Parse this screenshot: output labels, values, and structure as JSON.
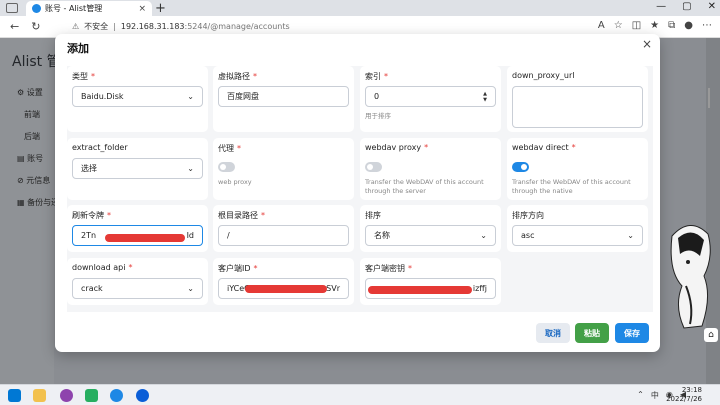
{
  "browser": {
    "tab_title": "账号 - Alist管理",
    "tab_close": "×",
    "new_tab": "+",
    "security": "不安全",
    "url_host": "192.168.31.183",
    "url_rest": ":5244/@manage/accounts"
  },
  "app": {
    "brand": "Alist 管",
    "menu": [
      {
        "label": "设置"
      },
      {
        "label": "前端"
      },
      {
        "label": "后端"
      },
      {
        "label": "账号"
      },
      {
        "label": "元信息"
      },
      {
        "label": "备份与还"
      }
    ]
  },
  "modal": {
    "title": "添加",
    "close": "×",
    "fields": {
      "type": {
        "label": "类型",
        "value": "Baidu.Disk"
      },
      "virtual_path": {
        "label": "虚拟路径",
        "value": "百度网盘"
      },
      "index": {
        "label": "索引",
        "value": "0",
        "help": "用于排序"
      },
      "down_proxy_url": {
        "label": "down_proxy_url",
        "value": ""
      },
      "extract_folder": {
        "label": "extract_folder",
        "value": "选择"
      },
      "proxy": {
        "label": "代理",
        "help": "web proxy",
        "on": false
      },
      "webdav_proxy": {
        "label": "webdav proxy",
        "help": "Transfer the WebDAV of this account through the server",
        "on": false
      },
      "webdav_direct": {
        "label": "webdav direct",
        "help": "Transfer the WebDAV of this account through the native",
        "on": true
      },
      "refresh_token": {
        "label": "刷新令牌",
        "value_start": "2Tn",
        "value_end": "Id"
      },
      "root_path": {
        "label": "根目录路径",
        "value": "/"
      },
      "order_by": {
        "label": "排序",
        "value": "名称"
      },
      "order_direction": {
        "label": "排序方向",
        "value": "asc"
      },
      "download_api": {
        "label": "download api",
        "value": "crack"
      },
      "client_id": {
        "label": "客户端ID",
        "value_start": "iYCeC",
        "value_end": "SVr"
      },
      "client_secret": {
        "label": "客户端密钥",
        "value_end": "izffj"
      }
    },
    "buttons": {
      "cancel": "取消",
      "paste": "粘贴",
      "save": "保存"
    }
  },
  "taskbar": {
    "time": "23:18",
    "date": "2022/7/26"
  },
  "colors": {
    "accent": "#1e88e5",
    "required": "#e53935",
    "paste": "#43a047"
  }
}
